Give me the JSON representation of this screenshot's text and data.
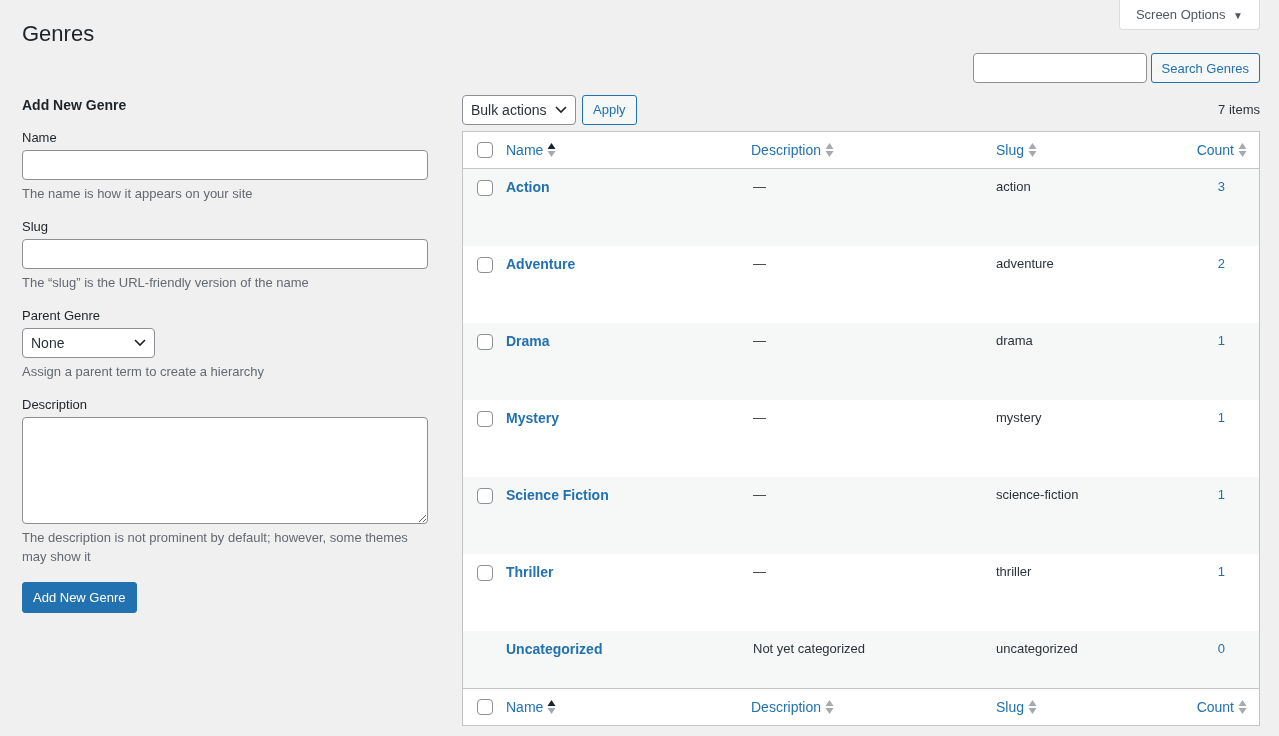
{
  "page_title": "Genres",
  "screen_options": {
    "label": "Screen Options",
    "arrow": "▼"
  },
  "search": {
    "button": "Search Genres"
  },
  "form": {
    "heading": "Add New Genre",
    "fields": [
      {
        "kind": "input",
        "label": "Name",
        "hint": "The name is how it appears on your site"
      },
      {
        "kind": "input",
        "label": "Slug",
        "hint": "The “slug” is the URL-friendly version of the name"
      },
      {
        "kind": "select",
        "label": "Parent Genre",
        "value": "None",
        "hint": "Assign a parent term to create a hierarchy"
      },
      {
        "kind": "textarea",
        "label": "Description",
        "hint": "The description is not prominent by default; however, some themes may show it"
      }
    ],
    "submit": "Add New Genre"
  },
  "bulk_actions": {
    "value": "Bulk actions",
    "apply": "Apply"
  },
  "items_count": "7 items",
  "table": {
    "select_all_checked": false,
    "columns": [
      {
        "label": "Name",
        "sorted": true
      },
      {
        "label": "Description",
        "sorted": false
      },
      {
        "label": "Slug",
        "sorted": false
      },
      {
        "label": "Count",
        "sorted": false
      }
    ],
    "rows": [
      {
        "name": "Action",
        "description": "—",
        "slug": "action",
        "count": "3",
        "checked": false
      },
      {
        "name": "Adventure",
        "description": "—",
        "slug": "adventure",
        "count": "2",
        "checked": false
      },
      {
        "name": "Drama",
        "description": "—",
        "slug": "drama",
        "count": "1",
        "checked": false
      },
      {
        "name": "Mystery",
        "description": "—",
        "slug": "mystery",
        "count": "1",
        "checked": false
      },
      {
        "name": "Science Fiction",
        "description": "—",
        "slug": "science-fiction",
        "count": "1",
        "checked": false
      },
      {
        "name": "Thriller",
        "description": "—",
        "slug": "thriller",
        "count": "1",
        "checked": false
      },
      {
        "name": "Uncategorized",
        "description": "Not yet categorized",
        "slug": "uncategorized",
        "count": "0"
      }
    ],
    "footer_select_all_checked": false,
    "footer_columns": [
      {
        "label": "Name",
        "sorted": true
      },
      {
        "label": "Description",
        "sorted": false
      },
      {
        "label": "Slug",
        "sorted": false
      },
      {
        "label": "Count",
        "sorted": false
      }
    ]
  }
}
